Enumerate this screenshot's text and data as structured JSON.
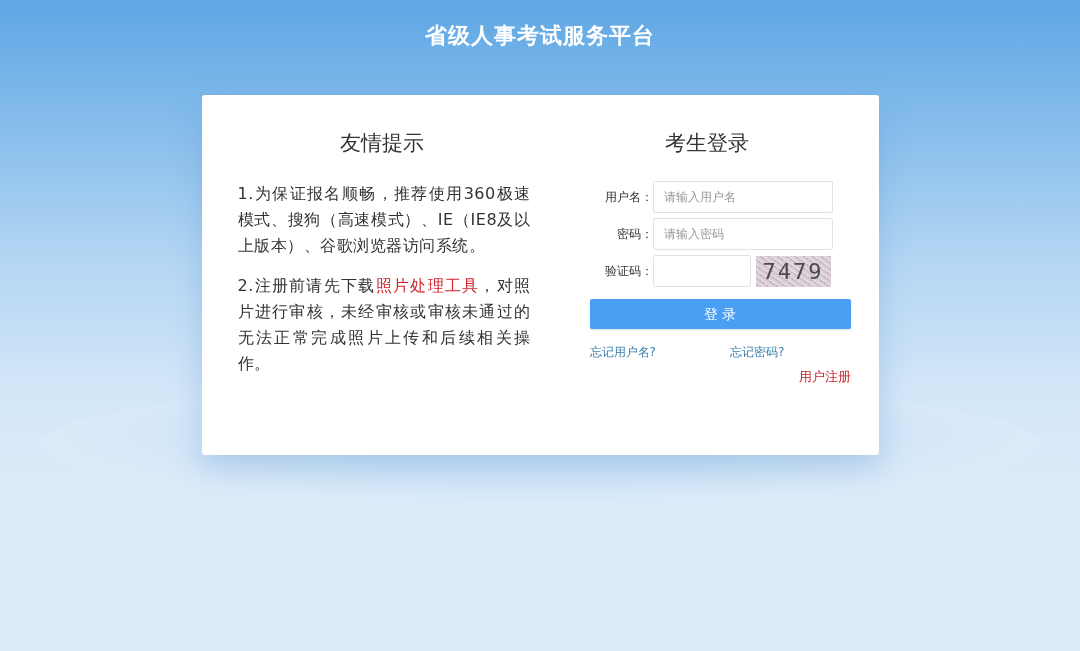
{
  "header": {
    "title": "省级人事考试服务平台"
  },
  "notice": {
    "title": "友情提示",
    "paragraphs": [
      {
        "text": "1.为保证报名顺畅，推荐使用360极速模式、搜狗（高速模式）、IE（IE8及以上版本）、谷歌浏览器访问系统。"
      },
      {
        "text": "2.注册前请先下载",
        "link": "照片处理工具",
        "text_after": "，对照片进行审核，未经审核或审核未通过的无法正常完成照片上传和后续相关操作。"
      }
    ]
  },
  "login": {
    "title": "考生登录",
    "fields": [
      {
        "kind": "text",
        "label": "用户名：",
        "placeholder": "请输入用户名"
      },
      {
        "kind": "password",
        "label": "密码：",
        "placeholder": "请输入密码"
      },
      {
        "kind": "captcha",
        "label": "验证码：",
        "captcha": "7479"
      }
    ],
    "submit": "登 录",
    "links": [
      {
        "kind": "help",
        "label": "忘记用户名?"
      },
      {
        "kind": "help",
        "label": "忘记密码?"
      },
      {
        "kind": "register",
        "label": "用户注册"
      }
    ]
  }
}
